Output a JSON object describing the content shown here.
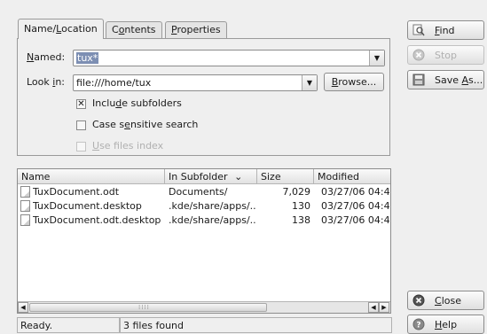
{
  "tabs": [
    {
      "label_pre": "Name/",
      "label_u": "L",
      "label_post": "ocation"
    },
    {
      "label_pre": "C",
      "label_u": "o",
      "label_post": "ntents"
    },
    {
      "label_pre": "",
      "label_u": "P",
      "label_post": "roperties"
    }
  ],
  "named": {
    "label_u": "N",
    "label_post": "amed:",
    "value": "tux*"
  },
  "look_in": {
    "label_pre": "Look ",
    "label_u": "i",
    "label_post": "n:",
    "value": "file:///home/tux"
  },
  "browse": {
    "label_u": "B",
    "label_post": "rowse..."
  },
  "options": {
    "include_subfolders": {
      "pre": "Inclu",
      "u": "d",
      "post": "e subfolders",
      "checked": true
    },
    "case_sensitive": {
      "pre": "Case s",
      "u": "e",
      "post": "nsitive search",
      "checked": false
    },
    "use_files_index": {
      "pre": "",
      "u": "U",
      "post": "se files index",
      "checked": false,
      "disabled": true
    }
  },
  "results": {
    "columns": [
      "Name",
      "In Subfolder",
      "Size",
      "Modified"
    ],
    "sort_indicator": "⌄",
    "rows": [
      {
        "name": "TuxDocument.odt",
        "folder": "Documents/",
        "size": "7,029",
        "modified": "03/27/06 04:47"
      },
      {
        "name": "TuxDocument.desktop",
        "folder": ".kde/share/apps/...",
        "size": "130",
        "modified": "03/27/06 04:45"
      },
      {
        "name": "TuxDocument.odt.desktop",
        "folder": ".kde/share/apps/...",
        "size": "138",
        "modified": "03/27/06 04:46"
      }
    ]
  },
  "status": {
    "ready": "Ready.",
    "count": "3 files found"
  },
  "actions": {
    "find": {
      "u": "F",
      "post": "ind"
    },
    "stop": {
      "u": "",
      "post": "Stop"
    },
    "save_as": {
      "pre": "Save ",
      "u": "A",
      "post": "s..."
    },
    "close": {
      "u": "C",
      "post": "lose"
    },
    "help": {
      "u": "H",
      "post": "elp"
    }
  },
  "colors": {
    "selection": "#7d8fb3",
    "window_bg": "#efefef"
  }
}
